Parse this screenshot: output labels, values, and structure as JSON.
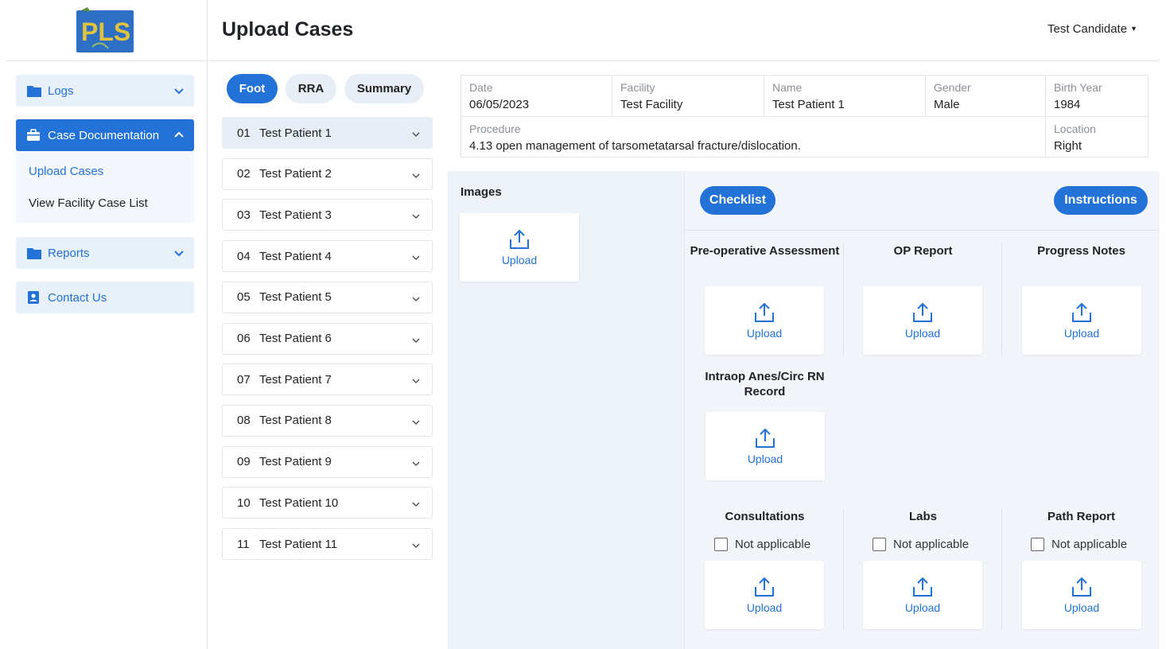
{
  "header": {
    "title": "Upload Cases",
    "user": "Test Candidate",
    "logo_text": "PLS"
  },
  "sidebar": {
    "logs": "Logs",
    "case_documentation": "Case Documentation",
    "sub_items": [
      "Upload Cases",
      "View Facility Case List"
    ],
    "reports": "Reports",
    "contact": "Contact Us"
  },
  "tabs": [
    "Foot",
    "RRA",
    "Summary"
  ],
  "patients": [
    {
      "num": "01",
      "name": "Test Patient 1"
    },
    {
      "num": "02",
      "name": "Test Patient 2"
    },
    {
      "num": "03",
      "name": "Test Patient 3"
    },
    {
      "num": "04",
      "name": "Test Patient 4"
    },
    {
      "num": "05",
      "name": "Test Patient 5"
    },
    {
      "num": "06",
      "name": "Test Patient 6"
    },
    {
      "num": "07",
      "name": "Test Patient 7"
    },
    {
      "num": "08",
      "name": "Test Patient 8"
    },
    {
      "num": "09",
      "name": "Test Patient 9"
    },
    {
      "num": "10",
      "name": "Test Patient 10"
    },
    {
      "num": "11",
      "name": "Test Patient 11"
    }
  ],
  "case_info": {
    "date_label": "Date",
    "date": "06/05/2023",
    "facility_label": "Facility",
    "facility": "Test Facility",
    "name_label": "Name",
    "name": "Test Patient 1",
    "gender_label": "Gender",
    "gender": "Male",
    "birth_year_label": "Birth Year",
    "birth_year": "1984",
    "procedure_label": "Procedure",
    "procedure": "4.13 open management of tarsometatarsal fracture/dislocation.",
    "location_label": "Location",
    "location": "Right"
  },
  "images": {
    "label": "Images",
    "upload": "Upload"
  },
  "buttons": {
    "checklist": "Checklist",
    "instructions": "Instructions"
  },
  "sections": {
    "preop": "Pre-operative Assessment",
    "op_report": "OP Report",
    "progress": "Progress Notes",
    "intraop": "Intraop Anes/Circ RN Record",
    "consultations": "Consultations",
    "labs": "Labs",
    "path": "Path Report"
  },
  "upload_label": "Upload",
  "not_applicable": "Not applicable",
  "colors": {
    "primary": "#2272d8",
    "light": "#e8f0fa"
  }
}
